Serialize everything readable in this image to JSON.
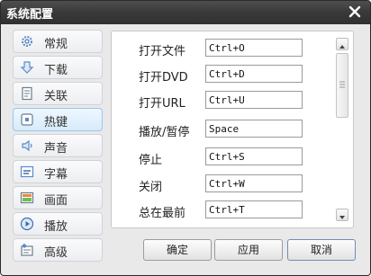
{
  "window": {
    "title": "系统配置"
  },
  "sidebar": {
    "items": [
      {
        "label": "常规",
        "icon": "gear-icon"
      },
      {
        "label": "下载",
        "icon": "download-arrow-icon"
      },
      {
        "label": "关联",
        "icon": "document-icon"
      },
      {
        "label": "热键",
        "icon": "keyboard-key-icon",
        "active": true
      },
      {
        "label": "声音",
        "icon": "speaker-icon"
      },
      {
        "label": "字幕",
        "icon": "subtitle-icon"
      },
      {
        "label": "画面",
        "icon": "picture-icon"
      },
      {
        "label": "播放",
        "icon": "play-icon"
      },
      {
        "label": "高级",
        "icon": "advanced-settings-icon"
      }
    ]
  },
  "hotkeys": [
    {
      "label": "打开文件",
      "value": "Ctrl+O"
    },
    {
      "label": "打开DVD",
      "value": "Ctrl+D"
    },
    {
      "label": "打开URL",
      "value": "Ctrl+U"
    },
    {
      "label": "播放/暂停",
      "value": "Space"
    },
    {
      "label": "停止",
      "value": "Ctrl+S"
    },
    {
      "label": "关闭",
      "value": "Ctrl+W"
    },
    {
      "label": "总在最前",
      "value": "Ctrl+T"
    }
  ],
  "buttons": {
    "ok": "确定",
    "apply": "应用",
    "cancel": "取消"
  }
}
